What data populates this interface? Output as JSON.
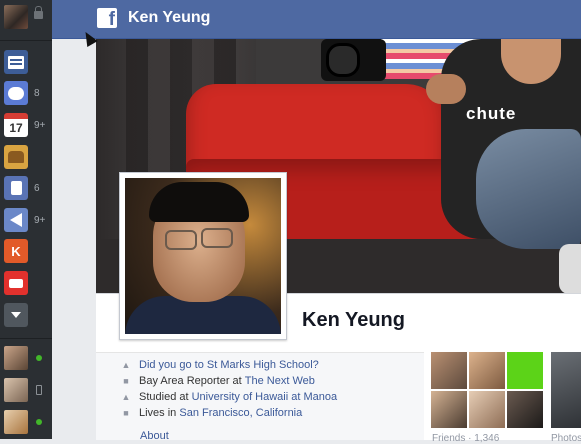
{
  "topbar": {
    "title": "Ken Yeung",
    "logo_glyph": "f"
  },
  "sidebar": {
    "apps": [
      {
        "name": "news-feed-icon",
        "badge": ""
      },
      {
        "name": "messages-icon",
        "badge": "8"
      },
      {
        "name": "events-icon",
        "glyph": "17",
        "badge": "9+"
      },
      {
        "name": "friends-icon",
        "badge": ""
      },
      {
        "name": "likes-icon",
        "badge": "6"
      },
      {
        "name": "notifications-icon",
        "badge": "9+"
      },
      {
        "name": "klout-icon",
        "glyph": "K",
        "badge": ""
      },
      {
        "name": "app-icon",
        "badge": ""
      },
      {
        "name": "more-icon",
        "badge": ""
      }
    ]
  },
  "profile": {
    "name": "Ken Yeung"
  },
  "cover": {
    "shirt_text": "chute"
  },
  "info": {
    "school_question": "Did you go to St Marks High School?",
    "work_prefix": "Bay Area Reporter at ",
    "work_link": "The Next Web",
    "study_prefix": "Studied at ",
    "study_link": "University of Hawaii at Manoa",
    "lives_prefix": "Lives in ",
    "lives_link": "San Francisco, California",
    "about_link": "About"
  },
  "friends": {
    "label": "Friends · 1,346"
  },
  "photos": {
    "label": "Photos"
  },
  "colors": {
    "brand": "#4e69a2",
    "link": "#3b5998",
    "online": "#42b72a"
  }
}
